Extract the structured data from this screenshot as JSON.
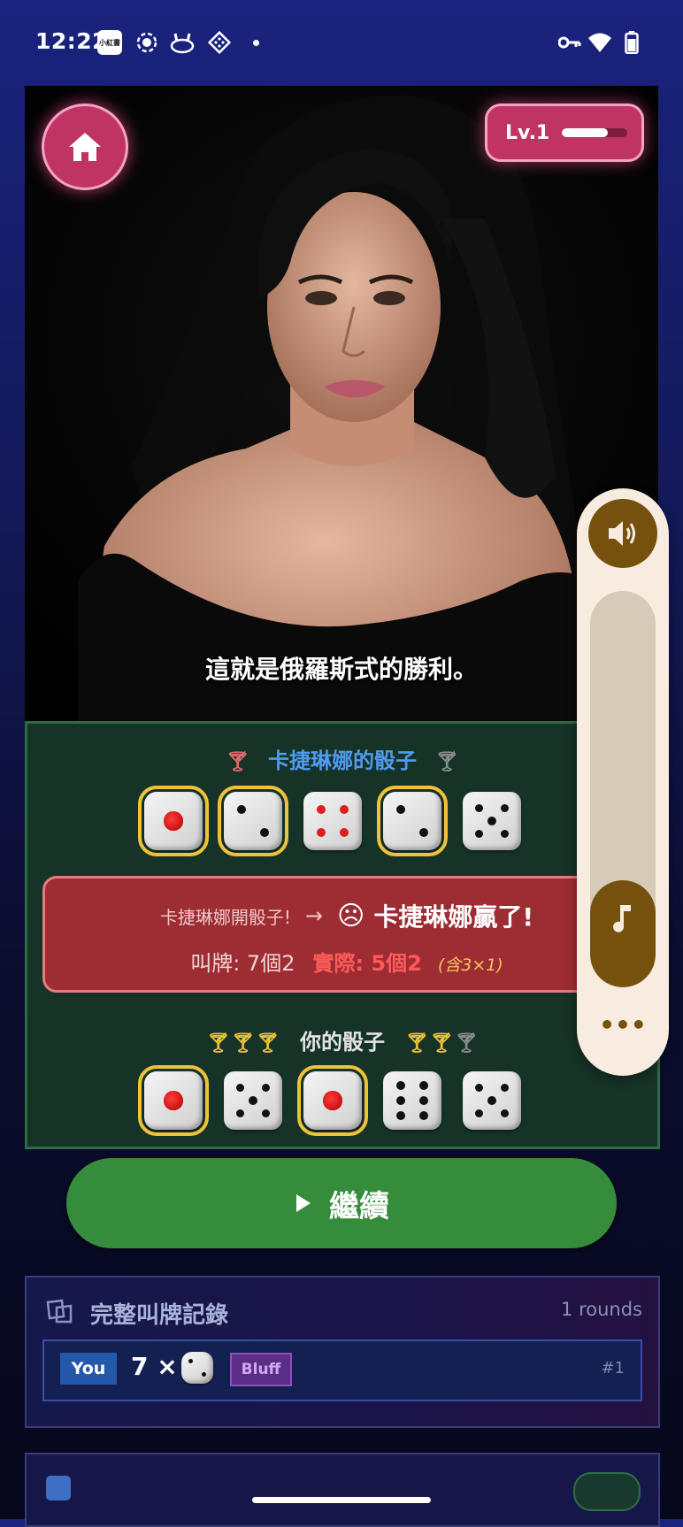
{
  "status_bar": {
    "time": "12:22",
    "app_badge": "小紅書",
    "icons": [
      "xiaohongshu-icon",
      "record-icon",
      "bunny-icon",
      "dice-app-icon",
      "dot-icon",
      "vpn-key-icon",
      "wifi-icon",
      "battery-icon"
    ]
  },
  "hero": {
    "home_icon": "home-icon",
    "level_label": "Lv.1",
    "level_progress": 0.7,
    "subtitle": "這就是俄羅斯式的勝利。"
  },
  "opponent": {
    "title": "卡捷琳娜的骰子",
    "title_color": "#4f9bef",
    "dice": [
      {
        "value": 1,
        "highlight": true
      },
      {
        "value": 2,
        "highlight": true
      },
      {
        "value": 4,
        "highlight": false
      },
      {
        "value": 2,
        "highlight": true
      },
      {
        "value": 5,
        "highlight": false
      }
    ]
  },
  "result": {
    "opens": "卡捷琳娜開骰子!",
    "arrow": "→",
    "face": "☹",
    "winner": "卡捷琳娜贏了!",
    "bid": "叫牌: 7個2",
    "actual": "實際: 5個2",
    "note": "(含3×1)"
  },
  "player": {
    "title": "你的骰子",
    "lives_left": [
      true,
      true,
      true
    ],
    "lives_right": [
      true,
      true,
      false
    ],
    "dice": [
      {
        "value": 1,
        "highlight": true
      },
      {
        "value": 5,
        "highlight": false
      },
      {
        "value": 1,
        "highlight": true
      },
      {
        "value": 6,
        "highlight": false
      },
      {
        "value": 5,
        "highlight": false
      }
    ]
  },
  "continue_button": {
    "label": "繼續"
  },
  "bid_log": {
    "title": "完整叫牌記錄",
    "rounds": "1 rounds",
    "rows": [
      {
        "player": "You",
        "quantity": "7 ×",
        "face": 2,
        "tag": "Bluff",
        "index": "#1"
      }
    ]
  },
  "volume_panel": {
    "level": 0.27,
    "more": "•••"
  },
  "colors": {
    "accent_pink": "#c03464",
    "win_red": "#9d2d33",
    "continue_green": "#358c3a",
    "gold": "#f0c238"
  }
}
